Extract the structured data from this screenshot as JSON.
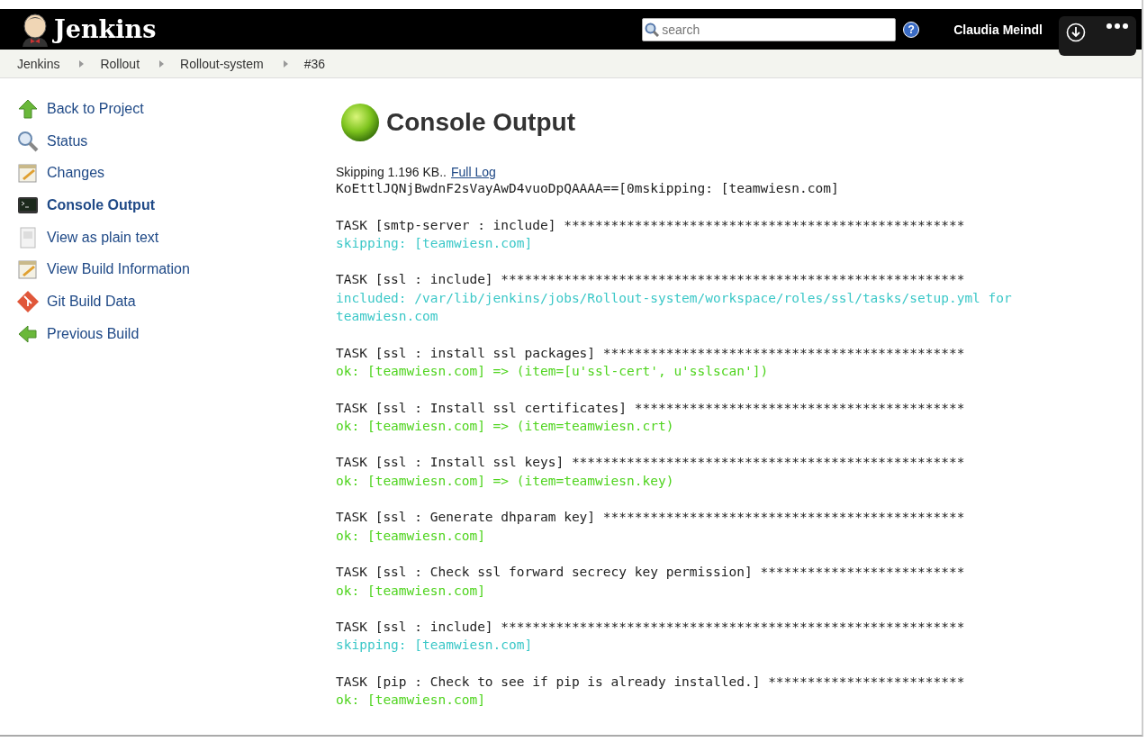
{
  "header": {
    "logo": "Jenkins",
    "search": {
      "placeholder": "search"
    },
    "help": "?",
    "user": "Claudia Meindl"
  },
  "breadcrumbs": [
    "Jenkins",
    "Rollout",
    "Rollout-system",
    "#36"
  ],
  "sidebar": {
    "items": [
      {
        "label": "Back to Project",
        "kind": "up",
        "selected": false
      },
      {
        "label": "Status",
        "kind": "search",
        "selected": false
      },
      {
        "label": "Changes",
        "kind": "notepad",
        "selected": false
      },
      {
        "label": "Console Output",
        "kind": "terminal",
        "selected": true
      },
      {
        "label": "View as plain text",
        "kind": "page",
        "selected": false
      },
      {
        "label": "View Build Information",
        "kind": "notepad",
        "selected": false
      },
      {
        "label": "Git Build Data",
        "kind": "git",
        "selected": false
      },
      {
        "label": "Previous Build",
        "kind": "left",
        "selected": false
      }
    ]
  },
  "main": {
    "title": "Console Output",
    "skipped": "Skipping 1.196 KB..",
    "full_log": "Full Log",
    "lines": [
      {
        "kind": "plain",
        "text": "KoEttlJQNjBwdnF2sVayAwD4vuoDpQAAAA==[0mskipping: [teamwiesn.com]"
      },
      {
        "kind": "blank"
      },
      {
        "kind": "plain",
        "text": "TASK [smtp-server : include] ***************************************************"
      },
      {
        "kind": "skip",
        "text": "skipping: [teamwiesn.com]"
      },
      {
        "kind": "blank"
      },
      {
        "kind": "plain",
        "text": "TASK [ssl : include] ***********************************************************"
      },
      {
        "kind": "skip",
        "text": "included: /var/lib/jenkins/jobs/Rollout-system/workspace/roles/ssl/tasks/setup.yml for teamwiesn.com"
      },
      {
        "kind": "blank"
      },
      {
        "kind": "plain",
        "text": "TASK [ssl : install ssl packages] **********************************************"
      },
      {
        "kind": "ok",
        "text": "ok: [teamwiesn.com] => (item=[u'ssl-cert', u'sslscan'])"
      },
      {
        "kind": "blank"
      },
      {
        "kind": "plain",
        "text": "TASK [ssl : Install ssl certificates] ******************************************"
      },
      {
        "kind": "ok",
        "text": "ok: [teamwiesn.com] => (item=teamwiesn.crt)"
      },
      {
        "kind": "blank"
      },
      {
        "kind": "plain",
        "text": "TASK [ssl : Install ssl keys] **************************************************"
      },
      {
        "kind": "ok",
        "text": "ok: [teamwiesn.com] => (item=teamwiesn.key)"
      },
      {
        "kind": "blank"
      },
      {
        "kind": "plain",
        "text": "TASK [ssl : Generate dhparam key] **********************************************"
      },
      {
        "kind": "ok",
        "text": "ok: [teamwiesn.com]"
      },
      {
        "kind": "blank"
      },
      {
        "kind": "plain",
        "text": "TASK [ssl : Check ssl forward secrecy key permission] **************************"
      },
      {
        "kind": "ok",
        "text": "ok: [teamwiesn.com]"
      },
      {
        "kind": "blank"
      },
      {
        "kind": "plain",
        "text": "TASK [ssl : include] ***********************************************************"
      },
      {
        "kind": "skip",
        "text": "skipping: [teamwiesn.com]"
      },
      {
        "kind": "blank"
      },
      {
        "kind": "plain",
        "text": "TASK [pip : Check to see if pip is already installed.] *************************"
      },
      {
        "kind": "ok",
        "text": "ok: [teamwiesn.com]"
      }
    ]
  }
}
